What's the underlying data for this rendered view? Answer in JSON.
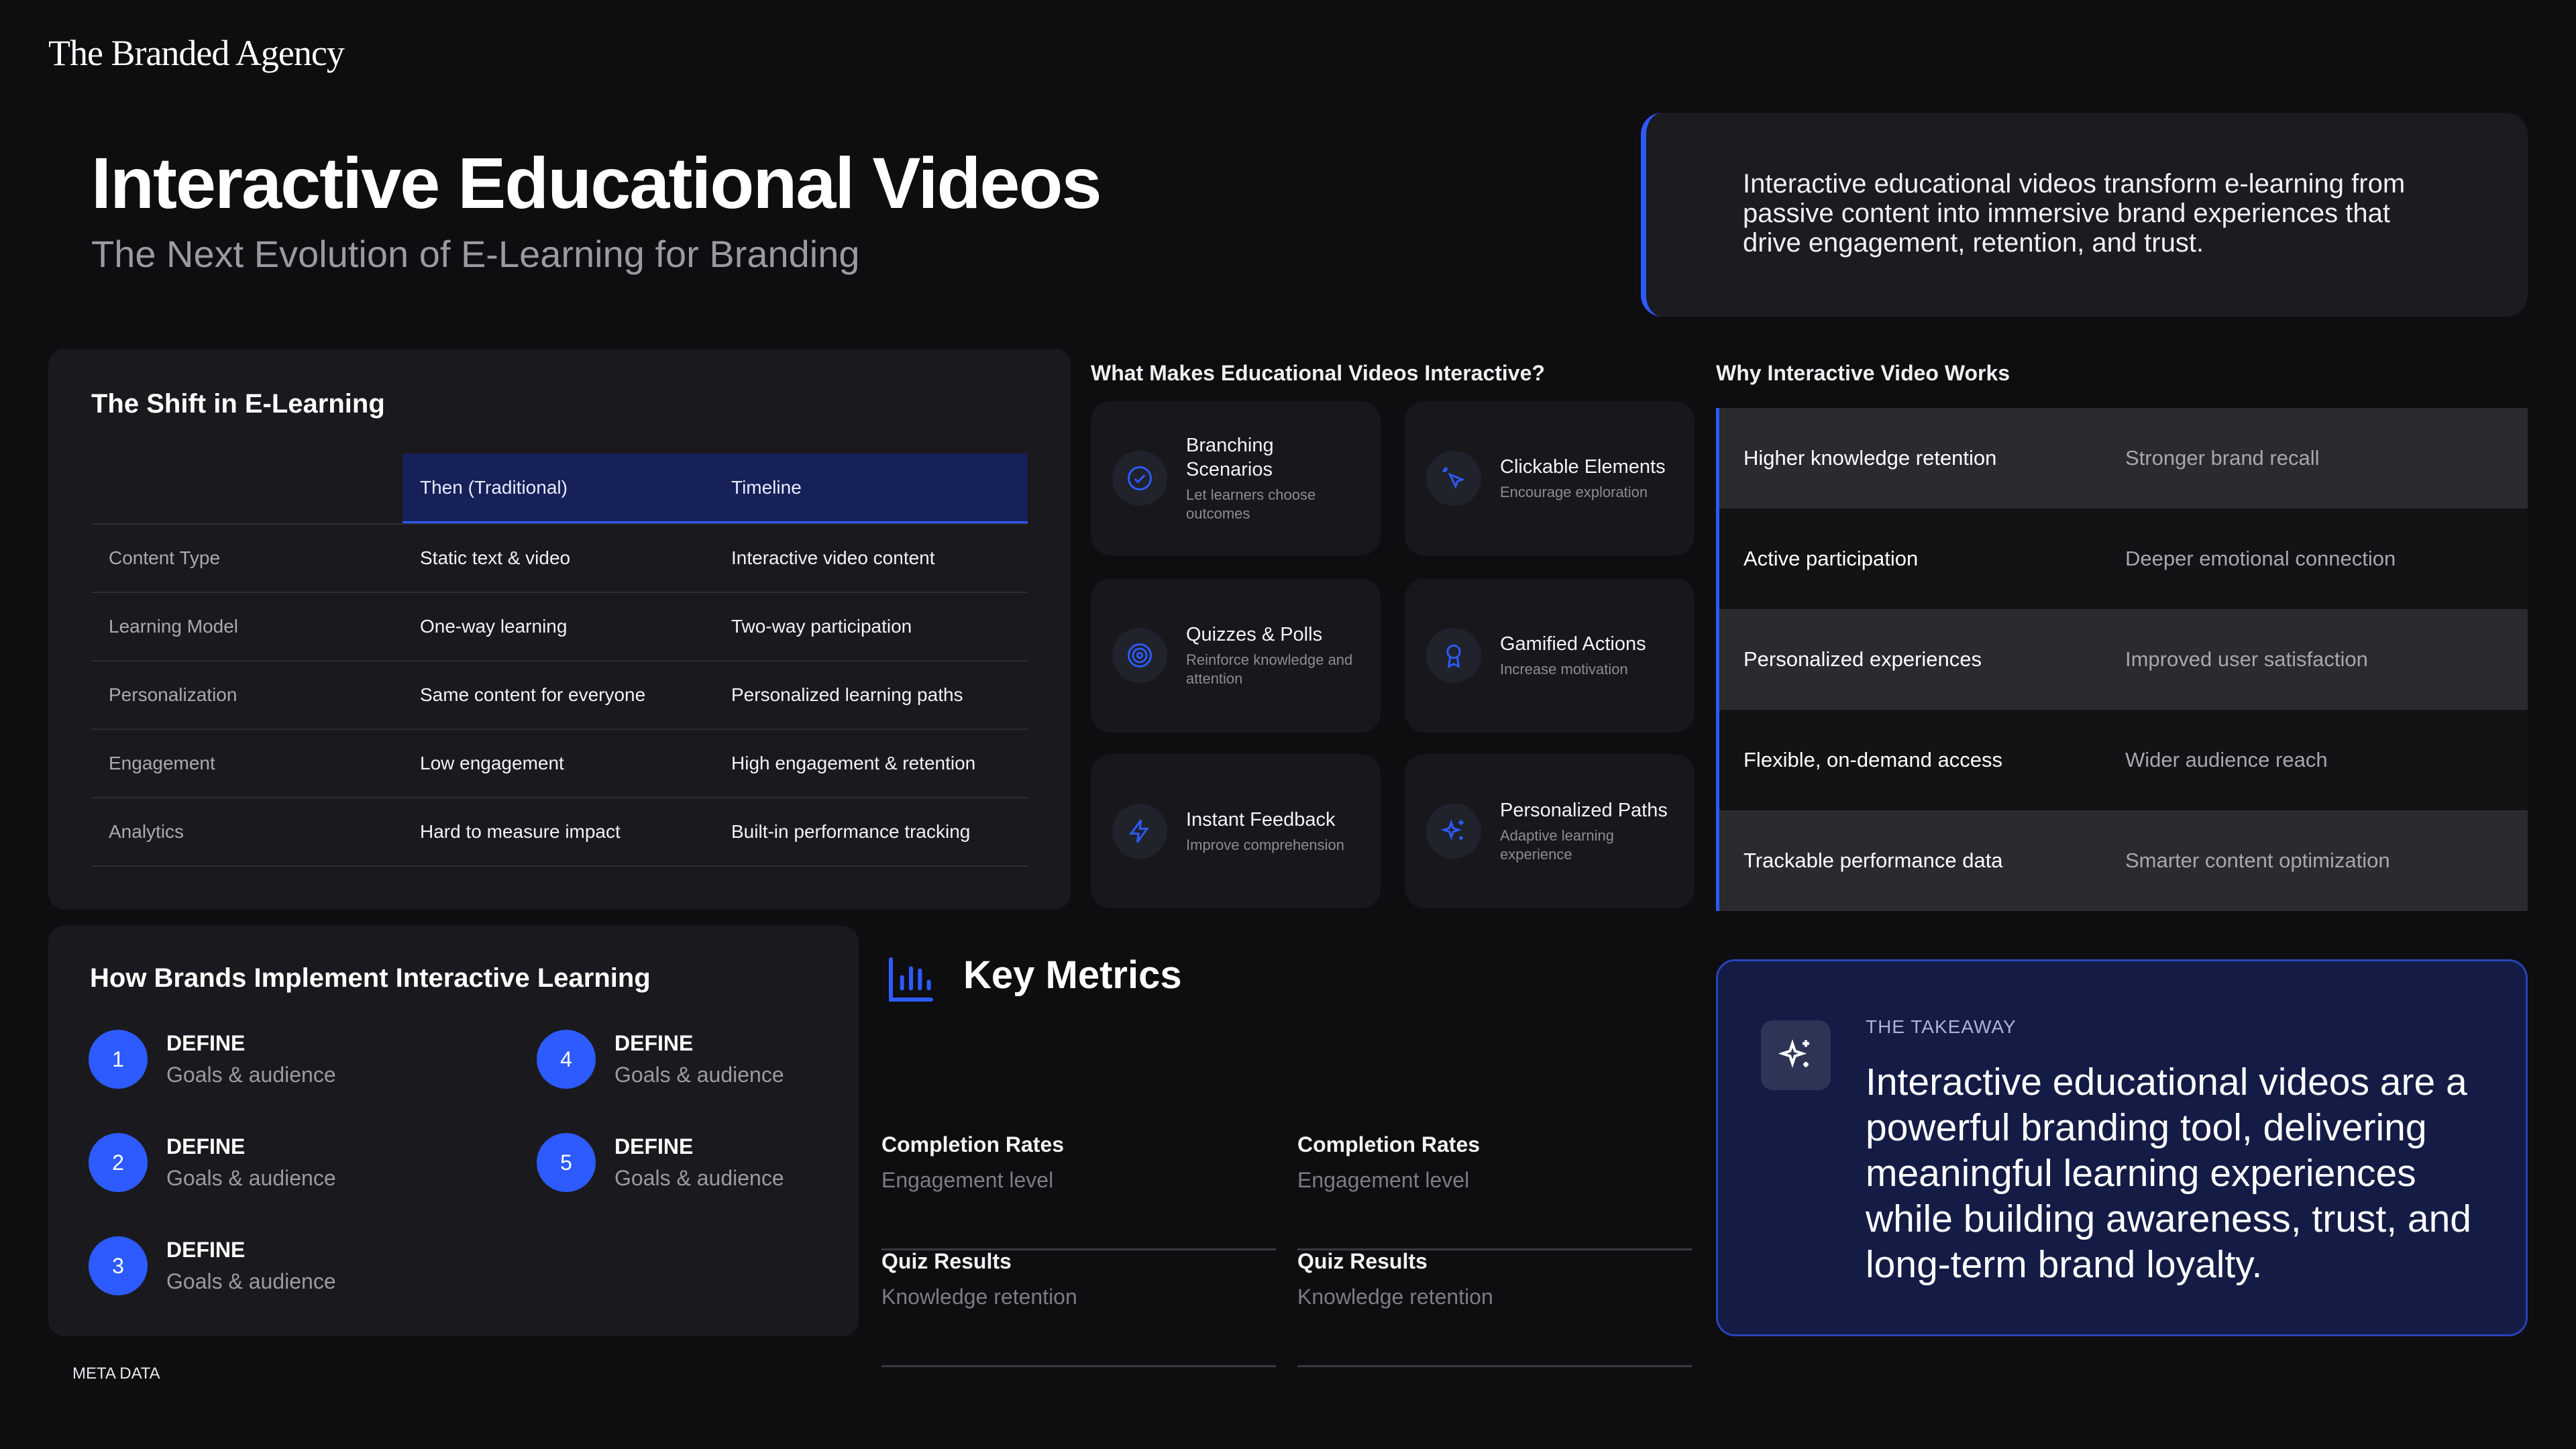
{
  "brand": {
    "logo_text": "The Branded Agency"
  },
  "hero": {
    "title": "Interactive Educational Videos",
    "subtitle": "The Next Evolution of E-Learning for Branding"
  },
  "intro": {
    "text": "Interactive educational videos transform e-learning from passive content into immersive brand experiences that drive engagement, retention, and trust."
  },
  "shift": {
    "title": "The Shift in E-Learning",
    "headers": [
      "",
      "Then (Traditional)",
      "Timeline"
    ],
    "rows": [
      [
        "Content Type",
        "Static text & video",
        "Interactive video content"
      ],
      [
        "Learning Model",
        "One-way learning",
        "Two-way participation"
      ],
      [
        "Personalization",
        "Same content for everyone",
        "Personalized learning paths"
      ],
      [
        "Engagement",
        "Low engagement",
        "High engagement & retention"
      ],
      [
        "Analytics",
        "Hard to measure impact",
        "Built-in performance tracking"
      ]
    ]
  },
  "features": {
    "title": "What Makes Educational Videos Interactive?",
    "items": [
      {
        "title": "Branching Scenarios",
        "desc": "Let learners choose outcomes",
        "icon": "check-circle-icon"
      },
      {
        "title": "Clickable Elements",
        "desc": "Encourage exploration",
        "icon": "cursor-click-icon"
      },
      {
        "title": "Quizzes & Polls",
        "desc": "Reinforce knowledge and attention",
        "icon": "target-icon"
      },
      {
        "title": "Gamified Actions",
        "desc": "Increase motivation",
        "icon": "award-icon"
      },
      {
        "title": "Instant Feedback",
        "desc": "Improve comprehension",
        "icon": "lightning-icon"
      },
      {
        "title": "Personalized Paths",
        "desc": "Adaptive learning experience",
        "icon": "sparkles-icon"
      }
    ]
  },
  "why": {
    "title": "Why Interactive Video Works",
    "rows": [
      [
        "Higher knowledge retention",
        "Stronger brand recall"
      ],
      [
        "Active participation",
        "Deeper emotional connection"
      ],
      [
        "Personalized experiences",
        "Improved user satisfaction"
      ],
      [
        "Flexible, on-demand access",
        "Wider audience reach"
      ],
      [
        "Trackable performance data",
        "Smarter content optimization"
      ]
    ]
  },
  "implement": {
    "title": "How Brands Implement Interactive Learning",
    "steps": [
      {
        "num": "1",
        "title": "DEFINE",
        "desc": "Goals & audience"
      },
      {
        "num": "2",
        "title": "DEFINE",
        "desc": "Goals & audience"
      },
      {
        "num": "3",
        "title": "DEFINE",
        "desc": "Goals & audience"
      },
      {
        "num": "4",
        "title": "DEFINE",
        "desc": "Goals & audience"
      },
      {
        "num": "5",
        "title": "DEFINE",
        "desc": "Goals & audience"
      }
    ]
  },
  "metrics": {
    "title": "Key Metrics",
    "items": [
      {
        "title": "Completion Rates",
        "desc": "Engagement level"
      },
      {
        "title": "Completion Rates",
        "desc": "Engagement level"
      },
      {
        "title": "Quiz Results",
        "desc": "Knowledge retention"
      },
      {
        "title": "Quiz Results",
        "desc": "Knowledge retention"
      }
    ]
  },
  "takeaway": {
    "label": "THE TAKEAWAY",
    "text": "Interactive educational videos are a powerful branding tool, delivering meaningful learning experiences while building awareness, trust, and long-term brand loyalty."
  },
  "footer": {
    "meta": "META DATA"
  },
  "colors": {
    "accent": "#2d5bff",
    "background": "#0e0e11",
    "panel": "#1a1a1e",
    "takeaway_bg": "#141c46"
  }
}
